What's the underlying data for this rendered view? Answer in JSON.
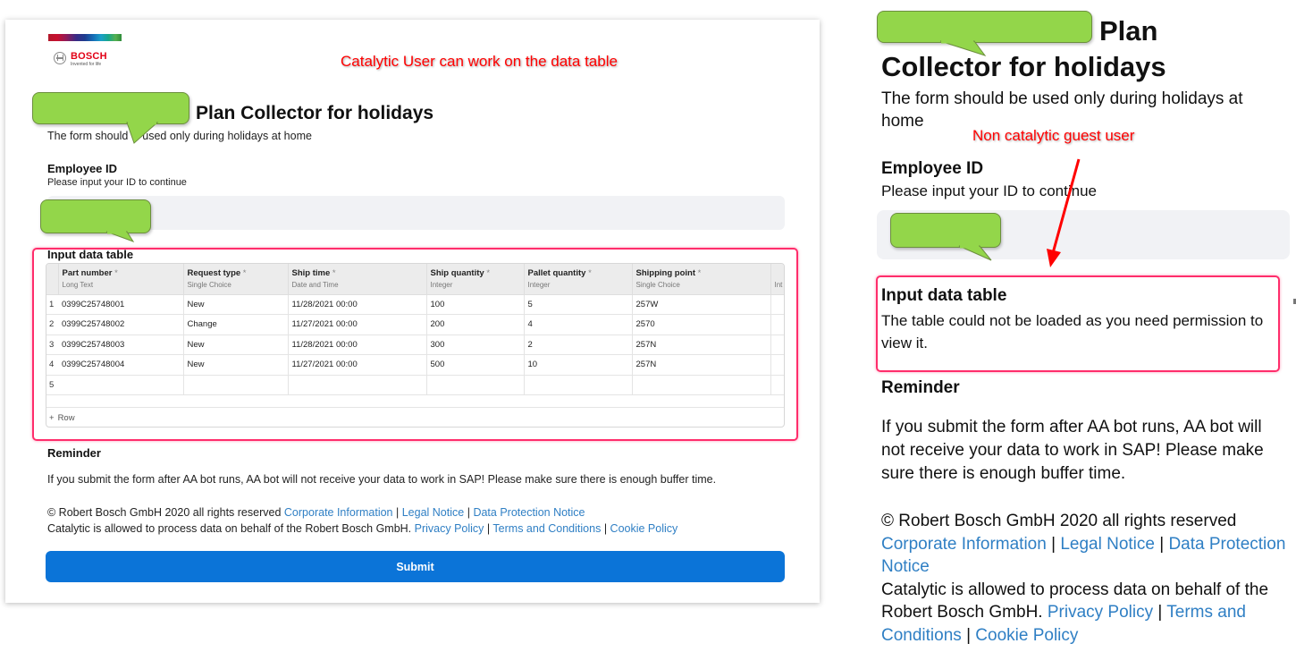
{
  "annotations": {
    "left_caption": "Catalytic User can work on the data table",
    "right_caption": "Non catalytic guest user"
  },
  "brand": {
    "name": "BOSCH",
    "tagline": "Invented for life",
    "logo_icon": "bosch-armature-icon",
    "accent_color": "#e20015"
  },
  "form": {
    "title_visible": "Plan Collector for holidays",
    "right_title_line1": "Plan",
    "right_title_line2": "Collector for holidays",
    "subtitle": "The form should be used only during holidays at home",
    "subtitle_left_visible": "The form should",
    "subtitle_left_rest": "e used only during holidays at home",
    "employee_id": {
      "label": "Employee ID",
      "help": "Please input your ID to continue",
      "value": "",
      "redacted": true
    },
    "data_table": {
      "label": "Input data table",
      "columns": [
        {
          "name": "Part number",
          "required": "*",
          "type": "Long Text"
        },
        {
          "name": "Request type",
          "required": "*",
          "type": "Single Choice"
        },
        {
          "name": "Ship time",
          "required": "*",
          "type": "Date and Time"
        },
        {
          "name": "Ship quantity",
          "required": "*",
          "type": "Integer"
        },
        {
          "name": "Pallet quantity",
          "required": "*",
          "type": "Integer"
        },
        {
          "name": "Shipping point",
          "required": "*",
          "type": "Single Choice"
        },
        {
          "name": "",
          "required": "",
          "type": "Int"
        }
      ],
      "rows": [
        {
          "index": "1",
          "cells": [
            "0399C25748001",
            "New",
            "11/28/2021 00:00",
            "100",
            "5",
            "257W",
            ""
          ]
        },
        {
          "index": "2",
          "cells": [
            "0399C25748002",
            "Change",
            "11/27/2021 00:00",
            "200",
            "4",
            "2570",
            ""
          ]
        },
        {
          "index": "3",
          "cells": [
            "0399C25748003",
            "New",
            "11/28/2021 00:00",
            "300",
            "2",
            "257N",
            ""
          ]
        },
        {
          "index": "4",
          "cells": [
            "0399C25748004",
            "New",
            "11/27/2021 00:00",
            "500",
            "10",
            "257N",
            ""
          ]
        },
        {
          "index": "5",
          "cells": [
            "",
            "",
            "",
            "",
            "",
            "",
            ""
          ]
        }
      ],
      "add_row_label": "Row",
      "add_row_icon": "plus-icon",
      "permission_message": "The table could not be loaded as you need permission to view it."
    },
    "reminder": {
      "label": "Reminder",
      "text": "If you submit the form after AA bot runs, AA bot will not receive your data to work in SAP! Please make sure there is enough buffer time."
    },
    "footer": {
      "copyright": "© Robert Bosch GmbH 2020 all rights reserved",
      "links1": [
        "Corporate Information",
        "Legal Notice",
        "Data Protection Notice"
      ],
      "catalytic_text": "Catalytic is allowed to process data on behalf of the Robert Bosch GmbH.",
      "links2": [
        "Privacy Policy",
        "Terms and Conditions",
        "Cookie Policy"
      ],
      "separator": "|",
      "link_color": "#2f7fc4"
    },
    "submit_label": "Submit",
    "submit_color": "#0b74d8"
  }
}
